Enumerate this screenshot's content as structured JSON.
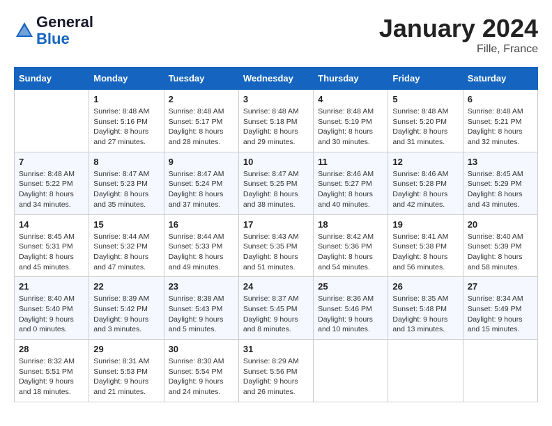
{
  "header": {
    "logo_line1": "General",
    "logo_line2": "Blue",
    "month": "January 2024",
    "location": "Fille, France"
  },
  "weekdays": [
    "Sunday",
    "Monday",
    "Tuesday",
    "Wednesday",
    "Thursday",
    "Friday",
    "Saturday"
  ],
  "weeks": [
    [
      {
        "day": "",
        "info": ""
      },
      {
        "day": "1",
        "info": "Sunrise: 8:48 AM\nSunset: 5:16 PM\nDaylight: 8 hours\nand 27 minutes."
      },
      {
        "day": "2",
        "info": "Sunrise: 8:48 AM\nSunset: 5:17 PM\nDaylight: 8 hours\nand 28 minutes."
      },
      {
        "day": "3",
        "info": "Sunrise: 8:48 AM\nSunset: 5:18 PM\nDaylight: 8 hours\nand 29 minutes."
      },
      {
        "day": "4",
        "info": "Sunrise: 8:48 AM\nSunset: 5:19 PM\nDaylight: 8 hours\nand 30 minutes."
      },
      {
        "day": "5",
        "info": "Sunrise: 8:48 AM\nSunset: 5:20 PM\nDaylight: 8 hours\nand 31 minutes."
      },
      {
        "day": "6",
        "info": "Sunrise: 8:48 AM\nSunset: 5:21 PM\nDaylight: 8 hours\nand 32 minutes."
      }
    ],
    [
      {
        "day": "7",
        "info": ""
      },
      {
        "day": "8",
        "info": "Sunrise: 8:47 AM\nSunset: 5:23 PM\nDaylight: 8 hours\nand 35 minutes."
      },
      {
        "day": "9",
        "info": "Sunrise: 8:47 AM\nSunset: 5:24 PM\nDaylight: 8 hours\nand 37 minutes."
      },
      {
        "day": "10",
        "info": "Sunrise: 8:47 AM\nSunset: 5:25 PM\nDaylight: 8 hours\nand 38 minutes."
      },
      {
        "day": "11",
        "info": "Sunrise: 8:46 AM\nSunset: 5:27 PM\nDaylight: 8 hours\nand 40 minutes."
      },
      {
        "day": "12",
        "info": "Sunrise: 8:46 AM\nSunset: 5:28 PM\nDaylight: 8 hours\nand 42 minutes."
      },
      {
        "day": "13",
        "info": "Sunrise: 8:45 AM\nSunset: 5:29 PM\nDaylight: 8 hours\nand 43 minutes."
      }
    ],
    [
      {
        "day": "14",
        "info": ""
      },
      {
        "day": "15",
        "info": "Sunrise: 8:44 AM\nSunset: 5:32 PM\nDaylight: 8 hours\nand 47 minutes."
      },
      {
        "day": "16",
        "info": "Sunrise: 8:44 AM\nSunset: 5:33 PM\nDaylight: 8 hours\nand 49 minutes."
      },
      {
        "day": "17",
        "info": "Sunrise: 8:43 AM\nSunset: 5:35 PM\nDaylight: 8 hours\nand 51 minutes."
      },
      {
        "day": "18",
        "info": "Sunrise: 8:42 AM\nSunset: 5:36 PM\nDaylight: 8 hours\nand 54 minutes."
      },
      {
        "day": "19",
        "info": "Sunrise: 8:41 AM\nSunset: 5:38 PM\nDaylight: 8 hours\nand 56 minutes."
      },
      {
        "day": "20",
        "info": "Sunrise: 8:40 AM\nSunset: 5:39 PM\nDaylight: 8 hours\nand 58 minutes."
      }
    ],
    [
      {
        "day": "21",
        "info": ""
      },
      {
        "day": "22",
        "info": "Sunrise: 8:39 AM\nSunset: 5:42 PM\nDaylight: 9 hours\nand 3 minutes."
      },
      {
        "day": "23",
        "info": "Sunrise: 8:38 AM\nSunset: 5:43 PM\nDaylight: 9 hours\nand 5 minutes."
      },
      {
        "day": "24",
        "info": "Sunrise: 8:37 AM\nSunset: 5:45 PM\nDaylight: 9 hours\nand 8 minutes."
      },
      {
        "day": "25",
        "info": "Sunrise: 8:36 AM\nSunset: 5:46 PM\nDaylight: 9 hours\nand 10 minutes."
      },
      {
        "day": "26",
        "info": "Sunrise: 8:35 AM\nSunset: 5:48 PM\nDaylight: 9 hours\nand 13 minutes."
      },
      {
        "day": "27",
        "info": "Sunrise: 8:34 AM\nSunset: 5:49 PM\nDaylight: 9 hours\nand 15 minutes."
      }
    ],
    [
      {
        "day": "28",
        "info": "Sunrise: 8:32 AM\nSunset: 5:51 PM\nDaylight: 9 hours\nand 18 minutes."
      },
      {
        "day": "29",
        "info": "Sunrise: 8:31 AM\nSunset: 5:53 PM\nDaylight: 9 hours\nand 21 minutes."
      },
      {
        "day": "30",
        "info": "Sunrise: 8:30 AM\nSunset: 5:54 PM\nDaylight: 9 hours\nand 24 minutes."
      },
      {
        "day": "31",
        "info": "Sunrise: 8:29 AM\nSunset: 5:56 PM\nDaylight: 9 hours\nand 26 minutes."
      },
      {
        "day": "",
        "info": ""
      },
      {
        "day": "",
        "info": ""
      },
      {
        "day": "",
        "info": ""
      }
    ]
  ],
  "week1_day7_info": "Sunrise: 8:48 AM\nSunset: 5:22 PM\nDaylight: 8 hours\nand 34 minutes.",
  "week2_day14_info": "Sunrise: 8:45 AM\nSunset: 5:31 PM\nDaylight: 8 hours\nand 45 minutes.",
  "week3_day21_info": "Sunrise: 8:40 AM\nSunset: 5:40 PM\nDaylight: 9 hours\nand 0 minutes."
}
